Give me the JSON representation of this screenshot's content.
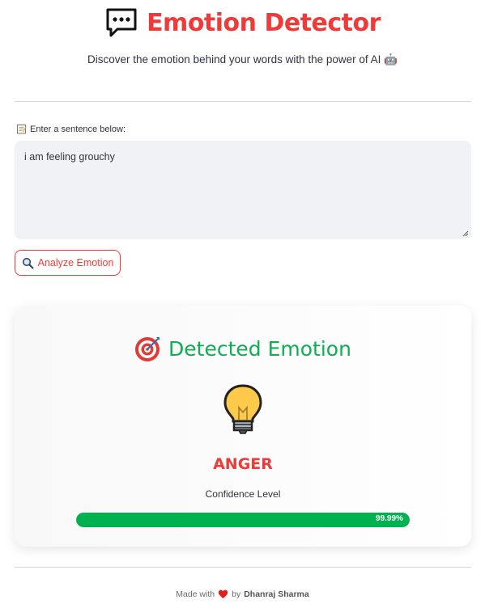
{
  "header": {
    "title": "Emotion Detector",
    "icon": "speech-bubble-icon",
    "subtitle": "Discover the emotion behind your words with the power of AI 🤖"
  },
  "input": {
    "label": "Enter a sentence below:",
    "label_icon": "memo-icon",
    "value": "i am feeling grouchy"
  },
  "analyze_button": {
    "label": "Analyze Emotion",
    "icon": "magnifier-icon"
  },
  "result": {
    "title": "Detected Emotion",
    "title_icon": "target-icon",
    "emotion_icon": "lightbulb-icon",
    "emotion": "ANGER",
    "confidence_label": "Confidence Level",
    "confidence_text": "99.99%",
    "confidence_value": 0.9999
  },
  "footer": {
    "made_with": "Made with",
    "by": "by",
    "author": "Dhanraj Sharma"
  },
  "colors": {
    "accent": "#f03a3a",
    "success": "#0fae55",
    "bar": "#00b14f",
    "input_bg": "#f0f2f6"
  }
}
